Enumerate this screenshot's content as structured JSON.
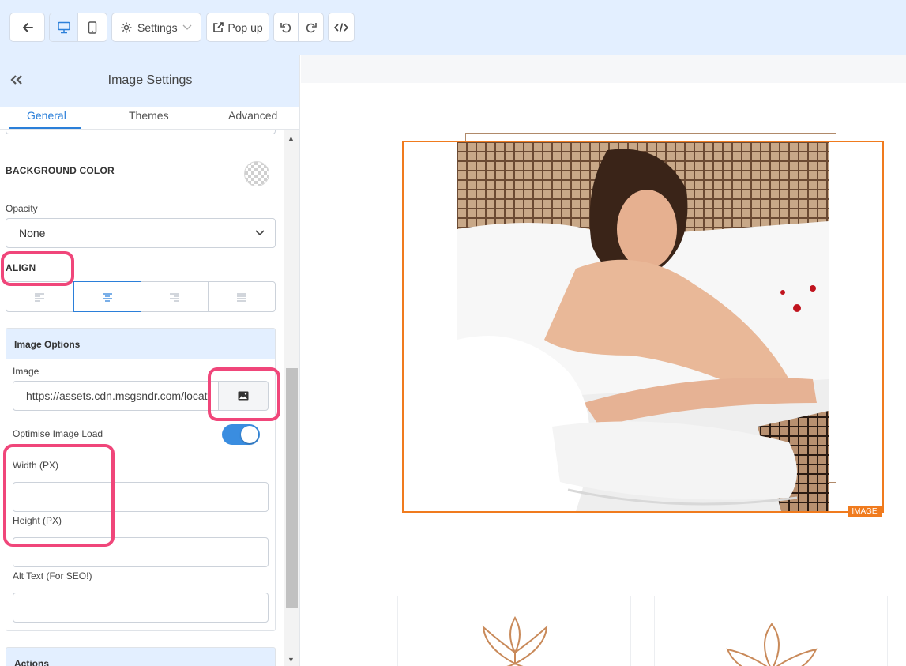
{
  "toolbar": {
    "settings_label": "Settings",
    "popup_label": "Pop up"
  },
  "panel": {
    "title": "Image Settings",
    "tabs": [
      {
        "label": "General"
      },
      {
        "label": "Themes"
      },
      {
        "label": "Advanced"
      }
    ],
    "background_color_label": "BACKGROUND COLOR",
    "opacity_label": "Opacity",
    "opacity_value": "None",
    "align_label": "ALIGN",
    "image_options": {
      "title": "Image Options",
      "image_label": "Image",
      "image_url": "https://assets.cdn.msgsndr.com/locati",
      "optimise_label": "Optimise Image Load",
      "optimise_on": true,
      "width_label": "Width (PX)",
      "width_value": "",
      "height_label": "Height (PX)",
      "height_value": "",
      "alt_label": "Alt Text (For SEO!)",
      "alt_value": ""
    },
    "actions_title": "Actions"
  },
  "canvas": {
    "image_tag": "IMAGE"
  },
  "colors": {
    "accent": "#2b7fd9",
    "highlight": "#f0467a",
    "selection": "#f07b1e",
    "header_bg": "#e3efff"
  }
}
